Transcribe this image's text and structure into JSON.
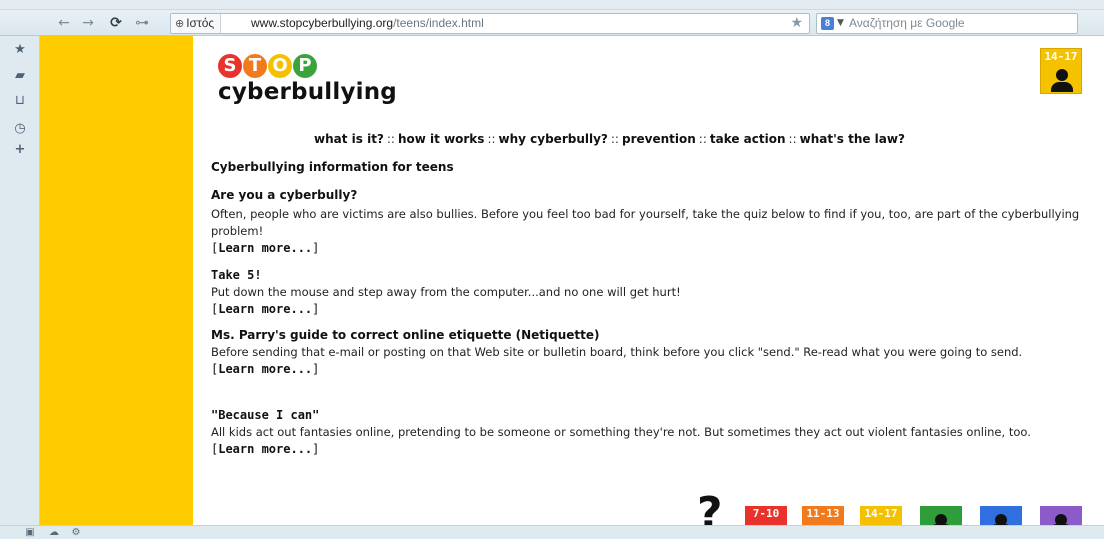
{
  "browser": {
    "nav": {
      "back_icon": "←",
      "forward_icon": "→",
      "reload_icon": "⟳",
      "key_icon": "⊶"
    },
    "site_chip": "Ιστός",
    "url_domain": "www.stopcyberbullying.org",
    "url_path": "/teens/index.html",
    "search_placeholder": "Αναζήτηση με Google",
    "search_engine_letter": "8",
    "colors": {
      "chrome": "#dfe9f0",
      "url_border": "#aebfcc"
    }
  },
  "sidebar": {
    "icons": [
      "star-icon",
      "notes-icon",
      "share-icon",
      "history-icon",
      "add-icon"
    ]
  },
  "page": {
    "logo": {
      "letters": [
        {
          "char": "S",
          "color": "#e8322b"
        },
        {
          "char": "T",
          "color": "#f07a1c"
        },
        {
          "char": "O",
          "color": "#f5c000"
        },
        {
          "char": "P",
          "color": "#3aa33b"
        }
      ],
      "word": "cyberbullying"
    },
    "age_badge_top": "14-17",
    "nav_links": [
      "what is it?",
      "how it works",
      "why cyberbully?",
      "prevention",
      "take action",
      "what's the law?"
    ],
    "nav_separator": "::",
    "section_title": "Cyberbullying information for teens",
    "articles": [
      {
        "title": "Are you a cyberbully?",
        "body": "Often, people who are victims are also bullies. Before you feel too bad for yourself, take the quiz below to find if you, too, are part of the cyberbullying problem!",
        "link": "Learn more..."
      },
      {
        "title": "Take 5!",
        "body": "Put down the mouse and step away from the computer...and no one will get hurt!",
        "link": "Learn more..."
      },
      {
        "title": "Ms. Parry's guide to correct online etiquette (Netiquette)",
        "body": "Before sending that e-mail or posting on that Web site or bulletin board, think before you click \"send.\" Re-read what you were going to send.",
        "link": "Learn more..."
      },
      {
        "title": "\"Because I can\"",
        "body": "All kids act out fantasies online, pretending to be someone or something they're not. But sometimes they act out violent fantasies online, too.",
        "link": "Learn more..."
      }
    ],
    "bottom_tiles": [
      {
        "label": "7-10",
        "color": "#e8322b"
      },
      {
        "label": "11-13",
        "color": "#f07a1c"
      },
      {
        "label": "14-17",
        "color": "#f5c000"
      },
      {
        "label": "",
        "color": "#2f9e3a"
      },
      {
        "label": "",
        "color": "#2f6fe0"
      },
      {
        "label": "",
        "color": "#8b5cc9"
      }
    ],
    "question_mark": "?",
    "colors": {
      "sidebar_yellow": "#ffcc00"
    }
  }
}
